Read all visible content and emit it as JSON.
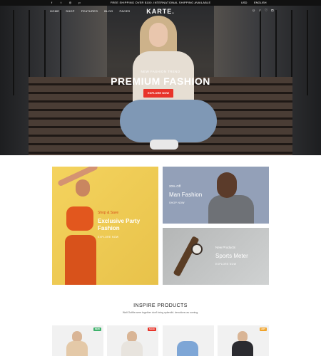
{
  "topbar": {
    "announcement": "FREE SHIPPING OVER $100. INTERNATIONAL SHIPPING AVAILABLE",
    "currency": "USD",
    "language": "ENGLISH",
    "social_icons": [
      "facebook-icon",
      "twitter-icon",
      "instagram-icon",
      "pinterest-icon"
    ]
  },
  "nav": {
    "logo": "KARTE.",
    "menu": [
      "HOME",
      "SHOP",
      "FEATURES",
      "BLOG",
      "PAGES"
    ],
    "icons": [
      "user-icon",
      "search-icon",
      "wishlist-icon",
      "cart-icon"
    ]
  },
  "hero": {
    "kicker": "NEW FASHION TREND",
    "title": "PREMIUM FASHION",
    "button": "EXPLORE NOW"
  },
  "promos": {
    "big": {
      "tag": "Shop & Save",
      "title": "Exclusive Party Fashion",
      "link": "EXPLORE NOW"
    },
    "man": {
      "tag": "20% Off",
      "title": "Man Fashion",
      "link": "SHOP NOW"
    },
    "watch": {
      "tag": "New Products",
      "title": "Sports Meter",
      "link": "EXPLORE NOW"
    }
  },
  "inspire": {
    "title": "INSPIRE PRODUCTS",
    "subtitle": "Wall Outfits were together don't bring splendid. denotions as coming."
  },
  "products": [
    {
      "badge": "NEW",
      "badge_color": "#3fb26c",
      "color": "#e4c9a8"
    },
    {
      "badge": "SALE",
      "badge_color": "#e8342a",
      "color": "#e8e4de"
    },
    {
      "badge": "",
      "badge_color": "#3fb26c",
      "color": "#7ea6d6"
    },
    {
      "badge": "HOT",
      "badge_color": "#f0a32a",
      "color": "#2b2b30"
    }
  ],
  "colors": {
    "accent": "#e8342a",
    "topbar_bg": "#111111"
  }
}
